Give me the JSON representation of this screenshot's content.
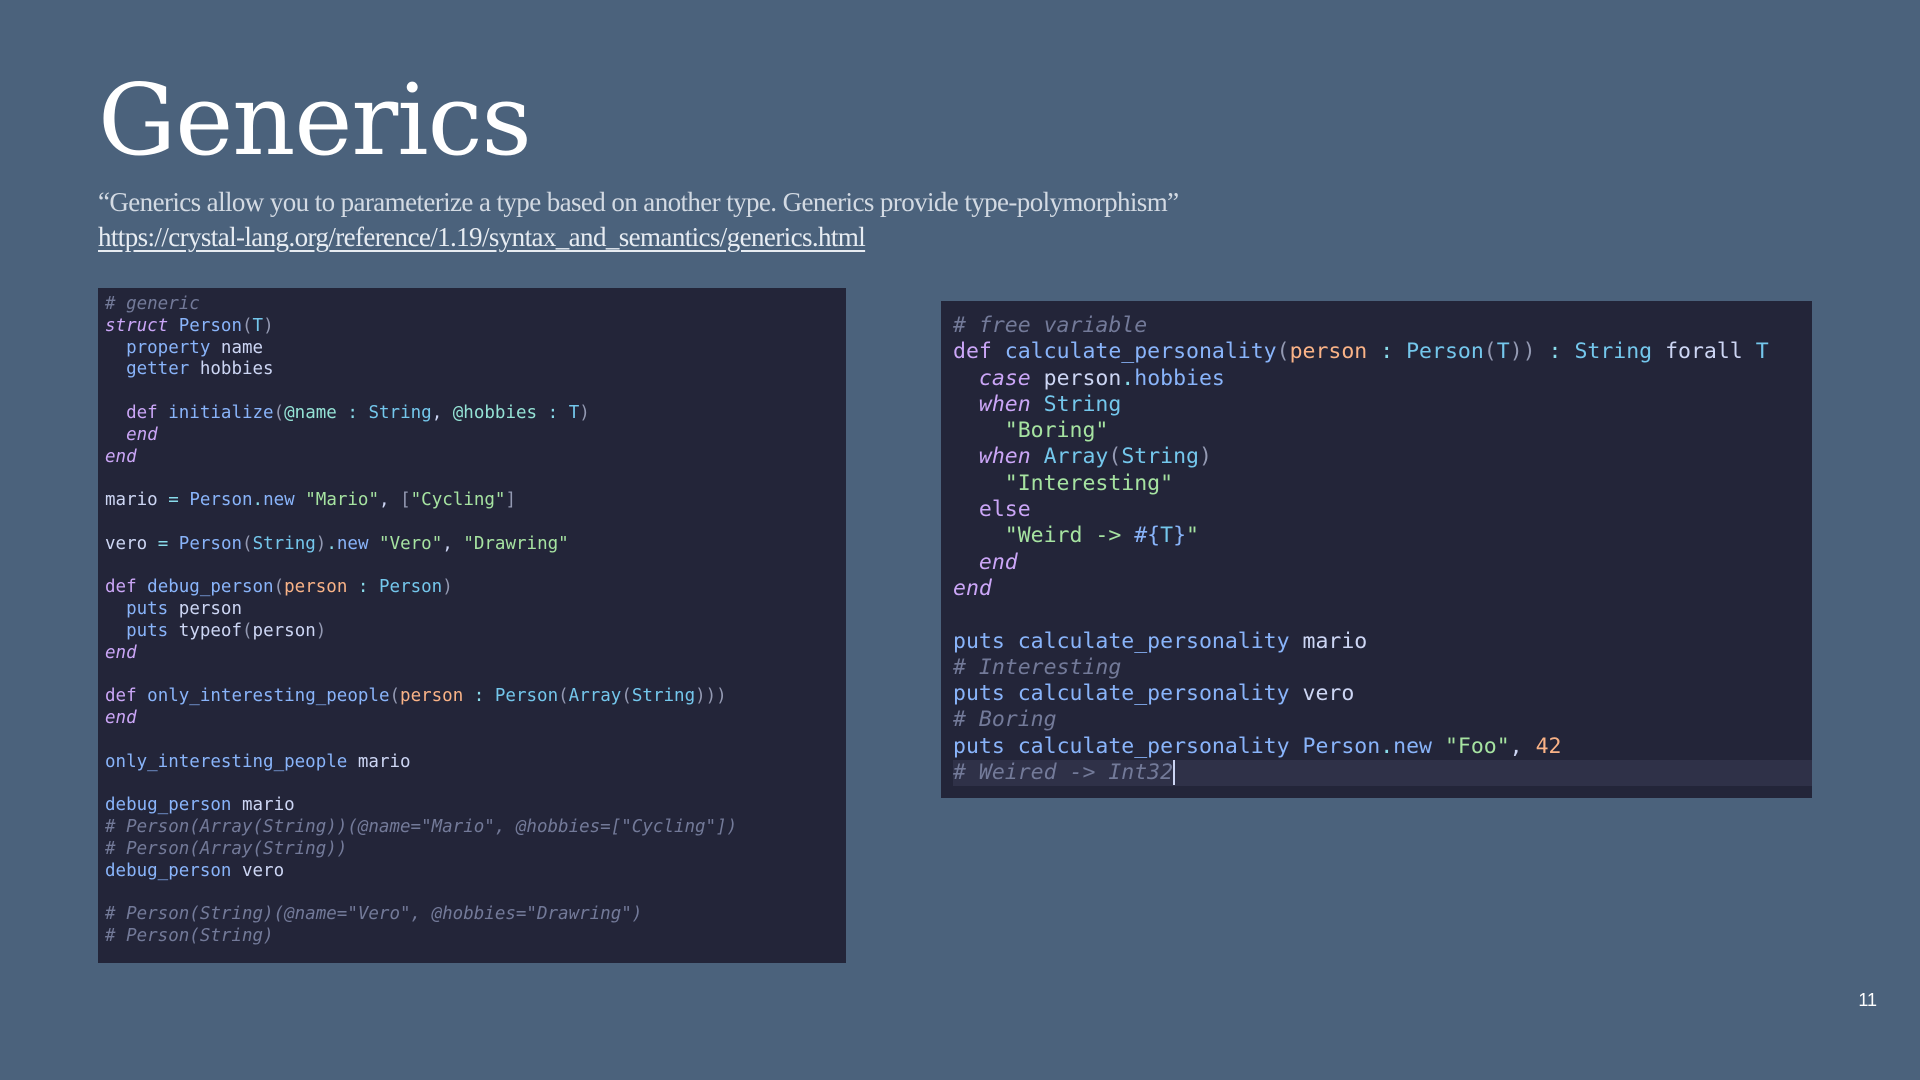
{
  "slide": {
    "title": "Generics",
    "quote": "“Generics allow you to parameterize a type based on another type. Generics provide type-polymorphism”",
    "link": "https://crystal-lang.org/reference/1.19/syntax_and_semantics/generics.html",
    "page_number": "11"
  },
  "left_code": {
    "l1": "# generic",
    "l2a": "struct",
    "l2b": "Person",
    "l2c": "T",
    "l3a": "property",
    "l3b": "name",
    "l4a": "getter",
    "l4b": "hobbies",
    "l6a": "def",
    "l6b": "initialize",
    "l6c": "@name",
    "l6d": "String",
    "l6e": "@hobbies",
    "l6f": "T",
    "l7": "end",
    "l8": "end",
    "l10a": "mario",
    "l10b": "Person",
    "l10c": "new",
    "l10d": "\"Mario\"",
    "l10e": "\"Cycling\"",
    "l12a": "vero",
    "l12b": "Person",
    "l12c": "String",
    "l12d": "new",
    "l12e": "\"Vero\"",
    "l12f": "\"Drawring\"",
    "l14a": "def",
    "l14b": "debug_person",
    "l14c": "person",
    "l14d": "Person",
    "l15a": "puts",
    "l15b": "person",
    "l16a": "puts",
    "l16b": "typeof",
    "l16c": "person",
    "l17": "end",
    "l19a": "def",
    "l19b": "only_interesting_people",
    "l19c": "person",
    "l19d": "Person",
    "l19e": "Array",
    "l19f": "String",
    "l20": "end",
    "l22a": "only_interesting_people",
    "l22b": "mario",
    "l24a": "debug_person",
    "l24b": "mario",
    "l25": "# Person(Array(String))(@name=\"Mario\", @hobbies=[\"Cycling\"])",
    "l26": "# Person(Array(String))",
    "l27a": "debug_person",
    "l27b": "vero",
    "l29": "# Person(String)(@name=\"Vero\", @hobbies=\"Drawring\")",
    "l30": "# Person(String)"
  },
  "right_code": {
    "r1": "# free variable",
    "r2a": "def",
    "r2b": "calculate_personality",
    "r2c": "person",
    "r2d": "Person",
    "r2e": "T",
    "r2f": "String",
    "r2g": "forall",
    "r2h": "T",
    "r3a": "case",
    "r3b": "person",
    "r3c": "hobbies",
    "r4a": "when",
    "r4b": "String",
    "r5": "\"Boring\"",
    "r6a": "when",
    "r6b": "Array",
    "r6c": "String",
    "r7": "\"Interesting\"",
    "r8": "else",
    "r9a": "\"Weird -> ",
    "r9b": "#{",
    "r9c": "T",
    "r9d": "}",
    "r9e": "\"",
    "r10": "end",
    "r11": "end",
    "r13a": "puts",
    "r13b": "calculate_personality",
    "r13c": "mario",
    "r14": "# Interesting",
    "r15a": "puts",
    "r15b": "calculate_personality",
    "r15c": "vero",
    "r16": "# Boring",
    "r17a": "puts",
    "r17b": "calculate_personality",
    "r17c": "Person",
    "r17d": "new",
    "r17e": "\"Foo\"",
    "r17f": "42",
    "r18": "# Weired -> Int32"
  }
}
